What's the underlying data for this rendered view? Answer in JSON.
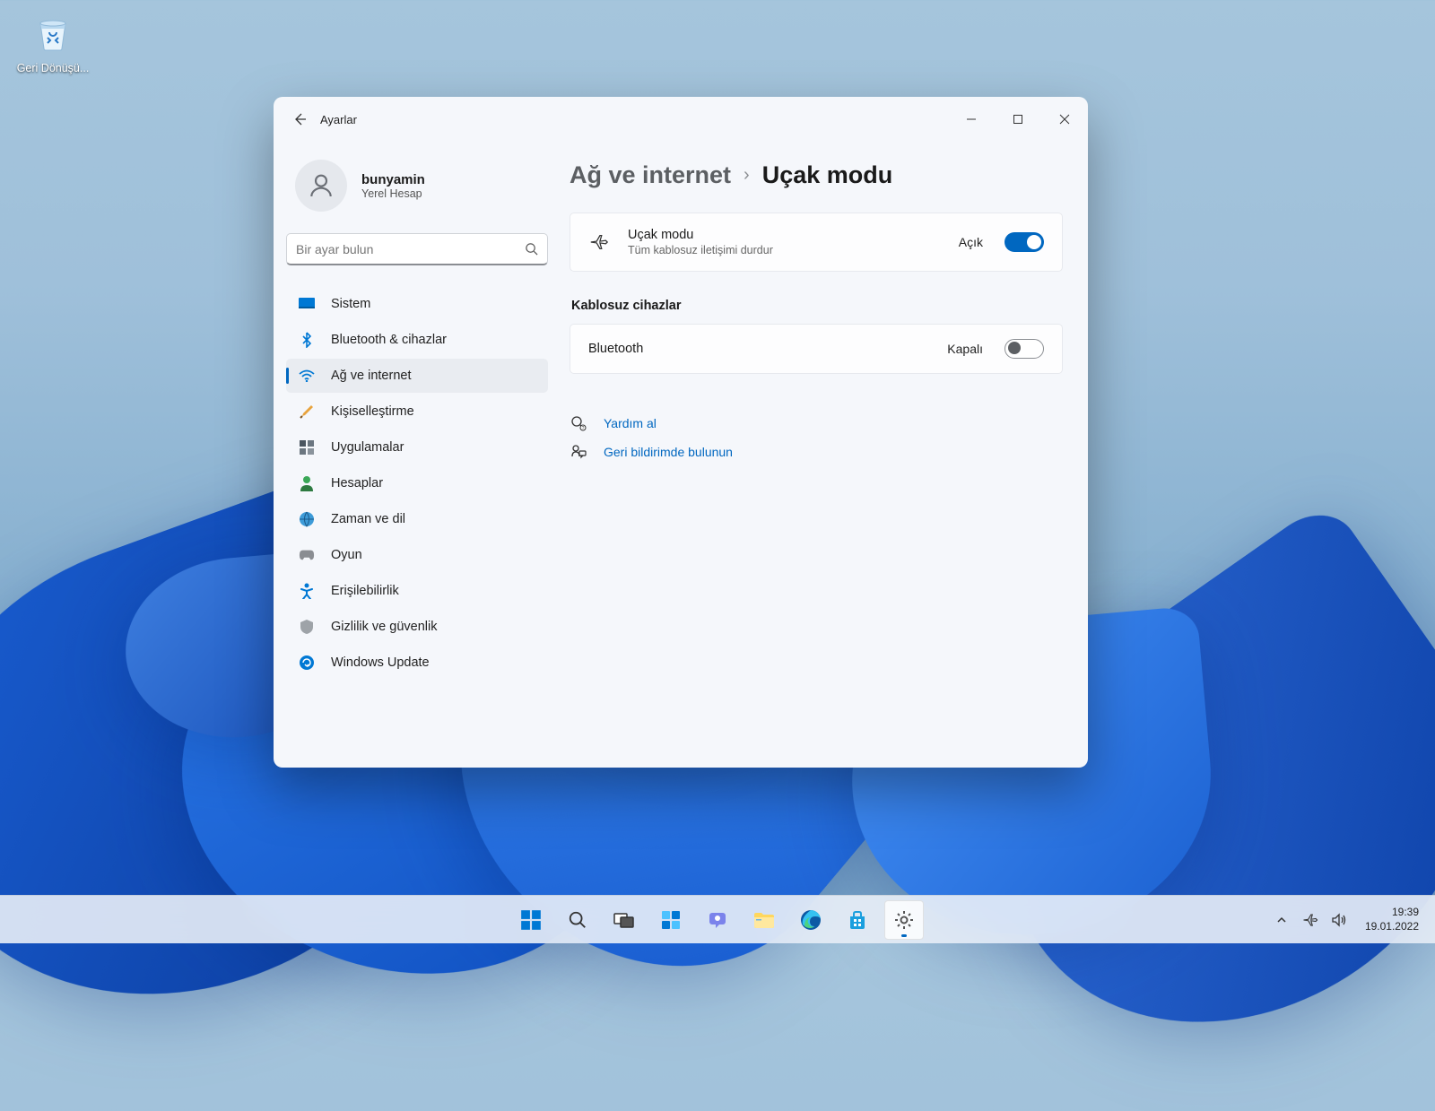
{
  "desktop": {
    "recycle_bin_label": "Geri Dönüşü..."
  },
  "window": {
    "title": "Ayarlar",
    "profile": {
      "name": "bunyamin",
      "subtitle": "Yerel Hesap"
    },
    "search_placeholder": "Bir ayar bulun",
    "nav": [
      {
        "label": "Sistem"
      },
      {
        "label": "Bluetooth & cihazlar"
      },
      {
        "label": "Ağ ve internet"
      },
      {
        "label": "Kişiselleştirme"
      },
      {
        "label": "Uygulamalar"
      },
      {
        "label": "Hesaplar"
      },
      {
        "label": "Zaman ve dil"
      },
      {
        "label": "Oyun"
      },
      {
        "label": "Erişilebilirlik"
      },
      {
        "label": "Gizlilik ve güvenlik"
      },
      {
        "label": "Windows Update"
      }
    ],
    "breadcrumb": {
      "parent": "Ağ ve internet",
      "current": "Uçak modu"
    },
    "airplane_card": {
      "title": "Uçak modu",
      "subtitle": "Tüm kablosuz iletişimi durdur",
      "state_label": "Açık"
    },
    "wireless_section_title": "Kablosuz cihazlar",
    "bluetooth_card": {
      "title": "Bluetooth",
      "state_label": "Kapalı"
    },
    "help": {
      "get_help": "Yardım al",
      "feedback": "Geri bildirimde bulunun"
    }
  },
  "taskbar": {
    "time": "19:39",
    "date": "19.01.2022"
  }
}
